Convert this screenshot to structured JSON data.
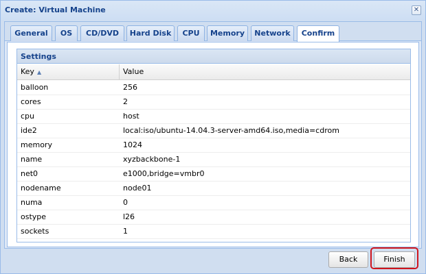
{
  "window": {
    "title": "Create: Virtual Machine",
    "close_glyph": "✕"
  },
  "tabs": [
    {
      "label": "General"
    },
    {
      "label": "OS"
    },
    {
      "label": "CD/DVD"
    },
    {
      "label": "Hard Disk"
    },
    {
      "label": "CPU"
    },
    {
      "label": "Memory"
    },
    {
      "label": "Network"
    },
    {
      "label": "Confirm",
      "active": true
    }
  ],
  "settings": {
    "title": "Settings",
    "columns": {
      "key": "Key",
      "value": "Value"
    },
    "sort_icon": "sort-ascending-icon",
    "rows": [
      {
        "key": "balloon",
        "value": "256"
      },
      {
        "key": "cores",
        "value": "2"
      },
      {
        "key": "cpu",
        "value": "host"
      },
      {
        "key": "ide2",
        "value": "local:iso/ubuntu-14.04.3-server-amd64.iso,media=cdrom"
      },
      {
        "key": "memory",
        "value": "1024"
      },
      {
        "key": "name",
        "value": "xyzbackbone-1"
      },
      {
        "key": "net0",
        "value": "e1000,bridge=vmbr0"
      },
      {
        "key": "nodename",
        "value": "node01"
      },
      {
        "key": "numa",
        "value": "0"
      },
      {
        "key": "ostype",
        "value": "l26"
      },
      {
        "key": "sockets",
        "value": "1"
      }
    ]
  },
  "buttons": {
    "back": "Back",
    "finish": "Finish"
  },
  "colors": {
    "accent": "#15428b",
    "highlight": "#d0141b"
  }
}
